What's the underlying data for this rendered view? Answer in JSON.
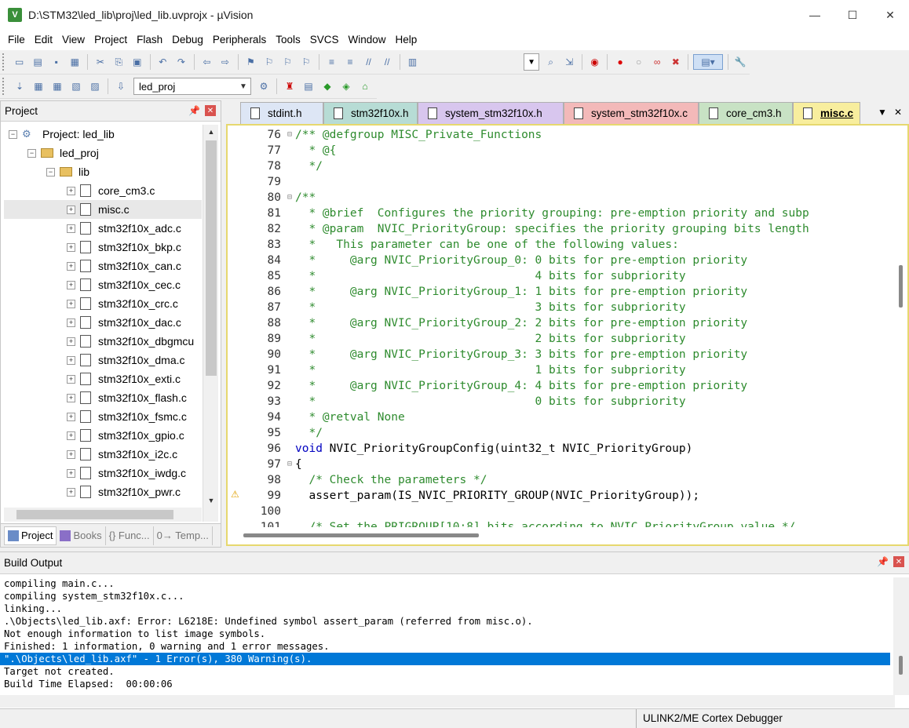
{
  "window": {
    "title": "D:\\STM32\\led_lib\\proj\\led_lib.uvprojx - µVision",
    "app_icon": "V",
    "minimize": "—",
    "maximize": "☐",
    "close": "✕"
  },
  "menu": [
    "File",
    "Edit",
    "View",
    "Project",
    "Flash",
    "Debug",
    "Peripherals",
    "Tools",
    "SVCS",
    "Window",
    "Help"
  ],
  "toolbar": {
    "target_combo": "led_proj"
  },
  "project_pane": {
    "title": "Project",
    "root": "Project: led_lib",
    "target": "led_proj",
    "group": "lib",
    "files": [
      "core_cm3.c",
      "misc.c",
      "stm32f10x_adc.c",
      "stm32f10x_bkp.c",
      "stm32f10x_can.c",
      "stm32f10x_cec.c",
      "stm32f10x_crc.c",
      "stm32f10x_dac.c",
      "stm32f10x_dbgmcu",
      "stm32f10x_dma.c",
      "stm32f10x_exti.c",
      "stm32f10x_flash.c",
      "stm32f10x_fsmc.c",
      "stm32f10x_gpio.c",
      "stm32f10x_i2c.c",
      "stm32f10x_iwdg.c",
      "stm32f10x_pwr.c"
    ],
    "selected_file": "misc.c",
    "bottom_tabs": [
      "Project",
      "Books",
      "{} Func...",
      "0→ Temp..."
    ]
  },
  "editor": {
    "tabs": [
      {
        "label": "stdint.h",
        "color": "#dde6f5"
      },
      {
        "label": "stm32f10x.h",
        "color": "#b7dcd5"
      },
      {
        "label": "system_stm32f10x.h",
        "color": "#d8c6ee"
      },
      {
        "label": "system_stm32f10x.c",
        "color": "#f3b9b9"
      },
      {
        "label": "core_cm3.h",
        "color": "#c8e2c4"
      },
      {
        "label": "misc.c",
        "color": "#f8ee9e",
        "active": true
      }
    ],
    "lines": [
      {
        "n": "76",
        "fold": "⊟",
        "segs": [
          [
            "cm",
            "/** @defgroup MISC_Private_Functions"
          ]
        ]
      },
      {
        "n": "77",
        "fold": "",
        "segs": [
          [
            "cm",
            "  * @{"
          ]
        ]
      },
      {
        "n": "78",
        "fold": "",
        "segs": [
          [
            "cm",
            "  */"
          ]
        ]
      },
      {
        "n": "79",
        "fold": "",
        "segs": [
          [
            "ct",
            ""
          ]
        ]
      },
      {
        "n": "80",
        "fold": "⊟",
        "segs": [
          [
            "cm",
            "/**"
          ]
        ]
      },
      {
        "n": "81",
        "fold": "",
        "segs": [
          [
            "cm",
            "  * @brief  Configures the priority grouping: pre-emption priority and subp"
          ]
        ]
      },
      {
        "n": "82",
        "fold": "",
        "segs": [
          [
            "cm",
            "  * @param  NVIC_PriorityGroup: specifies the priority grouping bits length"
          ]
        ]
      },
      {
        "n": "83",
        "fold": "",
        "segs": [
          [
            "cm",
            "  *   This parameter can be one of the following values:"
          ]
        ]
      },
      {
        "n": "84",
        "fold": "",
        "segs": [
          [
            "cm",
            "  *     @arg NVIC_PriorityGroup_0: 0 bits for pre-emption priority"
          ]
        ]
      },
      {
        "n": "85",
        "fold": "",
        "segs": [
          [
            "cm",
            "  *                                4 bits for subpriority"
          ]
        ]
      },
      {
        "n": "86",
        "fold": "",
        "segs": [
          [
            "cm",
            "  *     @arg NVIC_PriorityGroup_1: 1 bits for pre-emption priority"
          ]
        ]
      },
      {
        "n": "87",
        "fold": "",
        "segs": [
          [
            "cm",
            "  *                                3 bits for subpriority"
          ]
        ]
      },
      {
        "n": "88",
        "fold": "",
        "segs": [
          [
            "cm",
            "  *     @arg NVIC_PriorityGroup_2: 2 bits for pre-emption priority"
          ]
        ]
      },
      {
        "n": "89",
        "fold": "",
        "segs": [
          [
            "cm",
            "  *                                2 bits for subpriority"
          ]
        ]
      },
      {
        "n": "90",
        "fold": "",
        "segs": [
          [
            "cm",
            "  *     @arg NVIC_PriorityGroup_3: 3 bits for pre-emption priority"
          ]
        ]
      },
      {
        "n": "91",
        "fold": "",
        "segs": [
          [
            "cm",
            "  *                                1 bits for subpriority"
          ]
        ]
      },
      {
        "n": "92",
        "fold": "",
        "segs": [
          [
            "cm",
            "  *     @arg NVIC_PriorityGroup_4: 4 bits for pre-emption priority"
          ]
        ]
      },
      {
        "n": "93",
        "fold": "",
        "segs": [
          [
            "cm",
            "  *                                0 bits for subpriority"
          ]
        ]
      },
      {
        "n": "94",
        "fold": "",
        "segs": [
          [
            "cm",
            "  * @retval None"
          ]
        ]
      },
      {
        "n": "95",
        "fold": "",
        "segs": [
          [
            "cm",
            "  */"
          ]
        ]
      },
      {
        "n": "96",
        "fold": "",
        "segs": [
          [
            "kw",
            "void"
          ],
          [
            "ct",
            " NVIC_PriorityGroupConfig(uint32_t NVIC_PriorityGroup)"
          ]
        ]
      },
      {
        "n": "97",
        "fold": "⊟",
        "segs": [
          [
            "ct",
            "{"
          ]
        ]
      },
      {
        "n": "98",
        "fold": "",
        "segs": [
          [
            "ct",
            "  "
          ],
          [
            "cm",
            "/* Check the parameters */"
          ]
        ]
      },
      {
        "n": "99",
        "fold": "",
        "segs": [
          [
            "ct",
            "  assert_param(IS_NVIC_PRIORITY_GROUP(NVIC_PriorityGroup));"
          ]
        ]
      },
      {
        "n": "100",
        "fold": "",
        "segs": [
          [
            "ct",
            ""
          ]
        ]
      },
      {
        "n": "101",
        "fold": "",
        "segs": [
          [
            "ct",
            "  "
          ],
          [
            "cm",
            "/* Set the PRIGROUP[10:8] bits according to NVIC_PriorityGroup value */"
          ]
        ]
      }
    ]
  },
  "build_output": {
    "title": "Build Output",
    "lines": [
      "compiling main.c...",
      "compiling system_stm32f10x.c...",
      "linking...",
      ".\\Objects\\led_lib.axf: Error: L6218E: Undefined symbol assert_param (referred from misc.o).",
      "Not enough information to list image symbols.",
      "Finished: 1 information, 0 warning and 1 error messages.",
      "\".\\Objects\\led_lib.axf\" - 1 Error(s), 380 Warning(s).",
      "Target not created.",
      "Build Time Elapsed:  00:00:06"
    ],
    "highlighted_line": 6
  },
  "status": {
    "debugger": "ULINK2/ME Cortex Debugger"
  }
}
